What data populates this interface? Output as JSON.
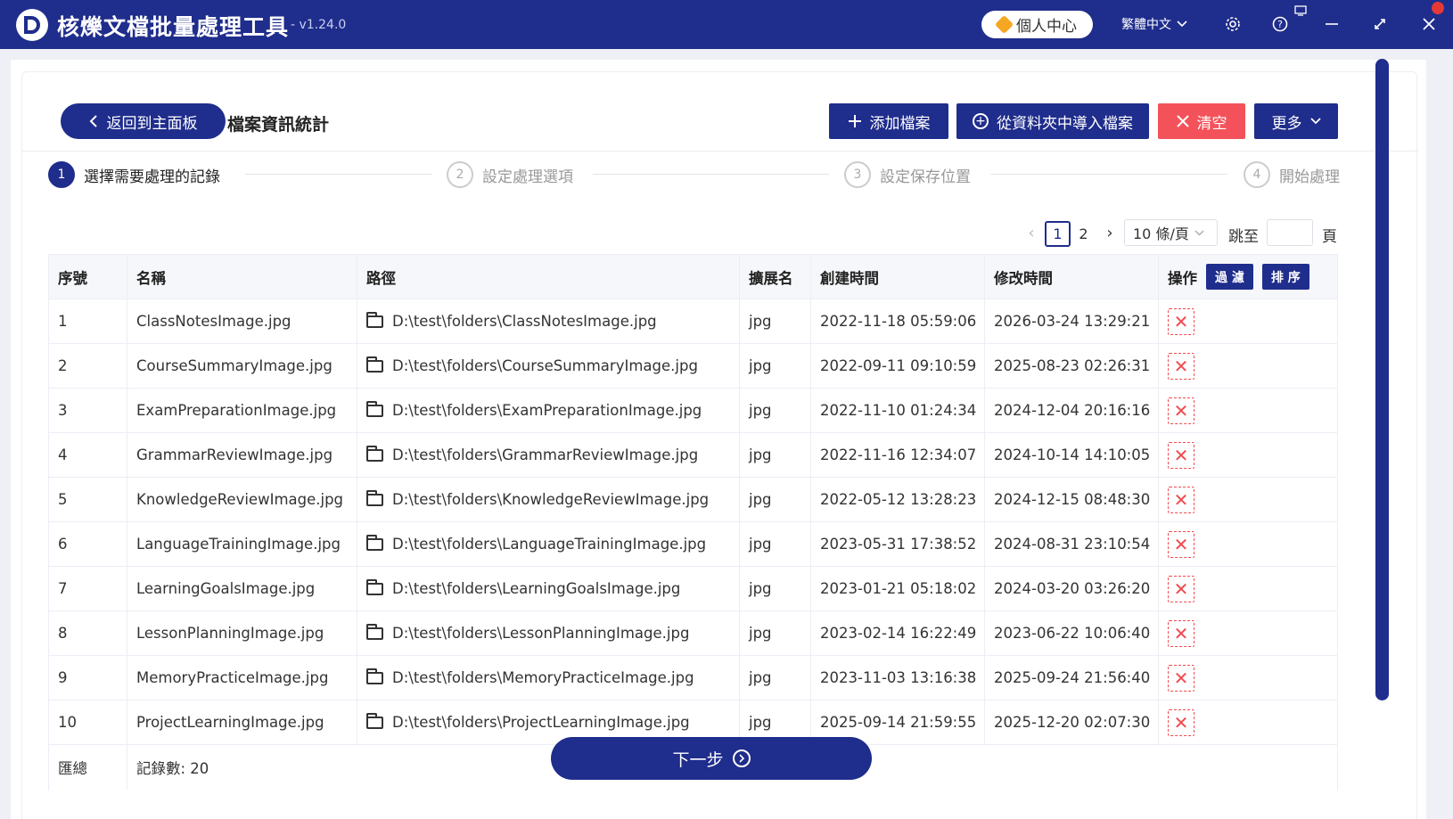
{
  "app": {
    "title": "核爍文檔批量處理工具",
    "version": "- v1.24.0",
    "user_center": "個人中心",
    "language": "繁體中文"
  },
  "header": {
    "back_label": "返回到主面板",
    "page_title": "檔案資訊統計",
    "add_file": "添加檔案",
    "import_folder": "從資料夾中導入檔案",
    "clear": "清空",
    "more": "更多"
  },
  "steps": [
    {
      "num": "1",
      "label": "選擇需要處理的記錄"
    },
    {
      "num": "2",
      "label": "設定處理選項"
    },
    {
      "num": "3",
      "label": "設定保存位置"
    },
    {
      "num": "4",
      "label": "開始處理"
    }
  ],
  "pagination": {
    "pages": [
      "1",
      "2"
    ],
    "current": "1",
    "page_size": "10 條/頁",
    "jump_label": "跳至",
    "page_unit": "頁"
  },
  "table": {
    "columns": [
      "序號",
      "名稱",
      "路徑",
      "擴展名",
      "創建時間",
      "修改時間",
      "操作"
    ],
    "filter_label": "過 濾",
    "sort_label": "排 序",
    "rows": [
      {
        "idx": "1",
        "name": "ClassNotesImage.jpg",
        "path": "D:\\test\\folders\\ClassNotesImage.jpg",
        "ext": "jpg",
        "created": "2022-11-18 05:59:06",
        "modified": "2026-03-24 13:29:21"
      },
      {
        "idx": "2",
        "name": "CourseSummaryImage.jpg",
        "path": "D:\\test\\folders\\CourseSummaryImage.jpg",
        "ext": "jpg",
        "created": "2022-09-11 09:10:59",
        "modified": "2025-08-23 02:26:31"
      },
      {
        "idx": "3",
        "name": "ExamPreparationImage.jpg",
        "path": "D:\\test\\folders\\ExamPreparationImage.jpg",
        "ext": "jpg",
        "created": "2022-11-10 01:24:34",
        "modified": "2024-12-04 20:16:16"
      },
      {
        "idx": "4",
        "name": "GrammarReviewImage.jpg",
        "path": "D:\\test\\folders\\GrammarReviewImage.jpg",
        "ext": "jpg",
        "created": "2022-11-16 12:34:07",
        "modified": "2024-10-14 14:10:05"
      },
      {
        "idx": "5",
        "name": "KnowledgeReviewImage.jpg",
        "path": "D:\\test\\folders\\KnowledgeReviewImage.jpg",
        "ext": "jpg",
        "created": "2022-05-12 13:28:23",
        "modified": "2024-12-15 08:48:30"
      },
      {
        "idx": "6",
        "name": "LanguageTrainingImage.jpg",
        "path": "D:\\test\\folders\\LanguageTrainingImage.jpg",
        "ext": "jpg",
        "created": "2023-05-31 17:38:52",
        "modified": "2024-08-31 23:10:54"
      },
      {
        "idx": "7",
        "name": "LearningGoalsImage.jpg",
        "path": "D:\\test\\folders\\LearningGoalsImage.jpg",
        "ext": "jpg",
        "created": "2023-01-21 05:18:02",
        "modified": "2024-03-20 03:26:20"
      },
      {
        "idx": "8",
        "name": "LessonPlanningImage.jpg",
        "path": "D:\\test\\folders\\LessonPlanningImage.jpg",
        "ext": "jpg",
        "created": "2023-02-14 16:22:49",
        "modified": "2023-06-22 10:06:40"
      },
      {
        "idx": "9",
        "name": "MemoryPracticeImage.jpg",
        "path": "D:\\test\\folders\\MemoryPracticeImage.jpg",
        "ext": "jpg",
        "created": "2023-11-03 13:16:38",
        "modified": "2025-09-24 21:56:40"
      },
      {
        "idx": "10",
        "name": "ProjectLearningImage.jpg",
        "path": "D:\\test\\folders\\ProjectLearningImage.jpg",
        "ext": "jpg",
        "created": "2025-09-14 21:59:55",
        "modified": "2025-12-20 02:07:30"
      }
    ],
    "summary_label": "匯總",
    "summary_value": "記錄數: 20"
  },
  "footer": {
    "next_label": "下一步"
  },
  "colors": {
    "primary": "#1f2d8c",
    "danger": "#f4525a"
  }
}
